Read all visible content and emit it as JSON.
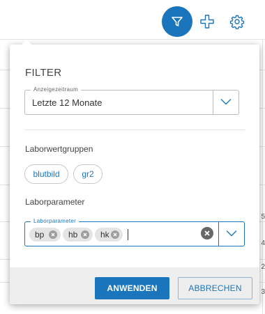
{
  "background": {
    "edge_digits": [
      "5",
      "4",
      "2",
      "3"
    ]
  },
  "toolbar": {
    "filter_icon": "filter-icon",
    "add_icon": "plus-icon",
    "settings_icon": "gear-icon",
    "accent_color": "#1b75bc"
  },
  "filter_panel": {
    "title": "FILTER",
    "time_range": {
      "label": "Anzeigezeitraum",
      "value": "Letzte 12 Monate"
    },
    "lab_groups": {
      "label": "Laborwertgruppen",
      "chips": [
        "blutbild",
        "gr2"
      ]
    },
    "lab_params": {
      "section_label": "Laborparameter",
      "field_label": "Laborparameter",
      "selected": [
        "bp",
        "hb",
        "hk"
      ]
    },
    "actions": {
      "apply": "ANWENDEN",
      "cancel": "ABBRECHEN"
    }
  }
}
